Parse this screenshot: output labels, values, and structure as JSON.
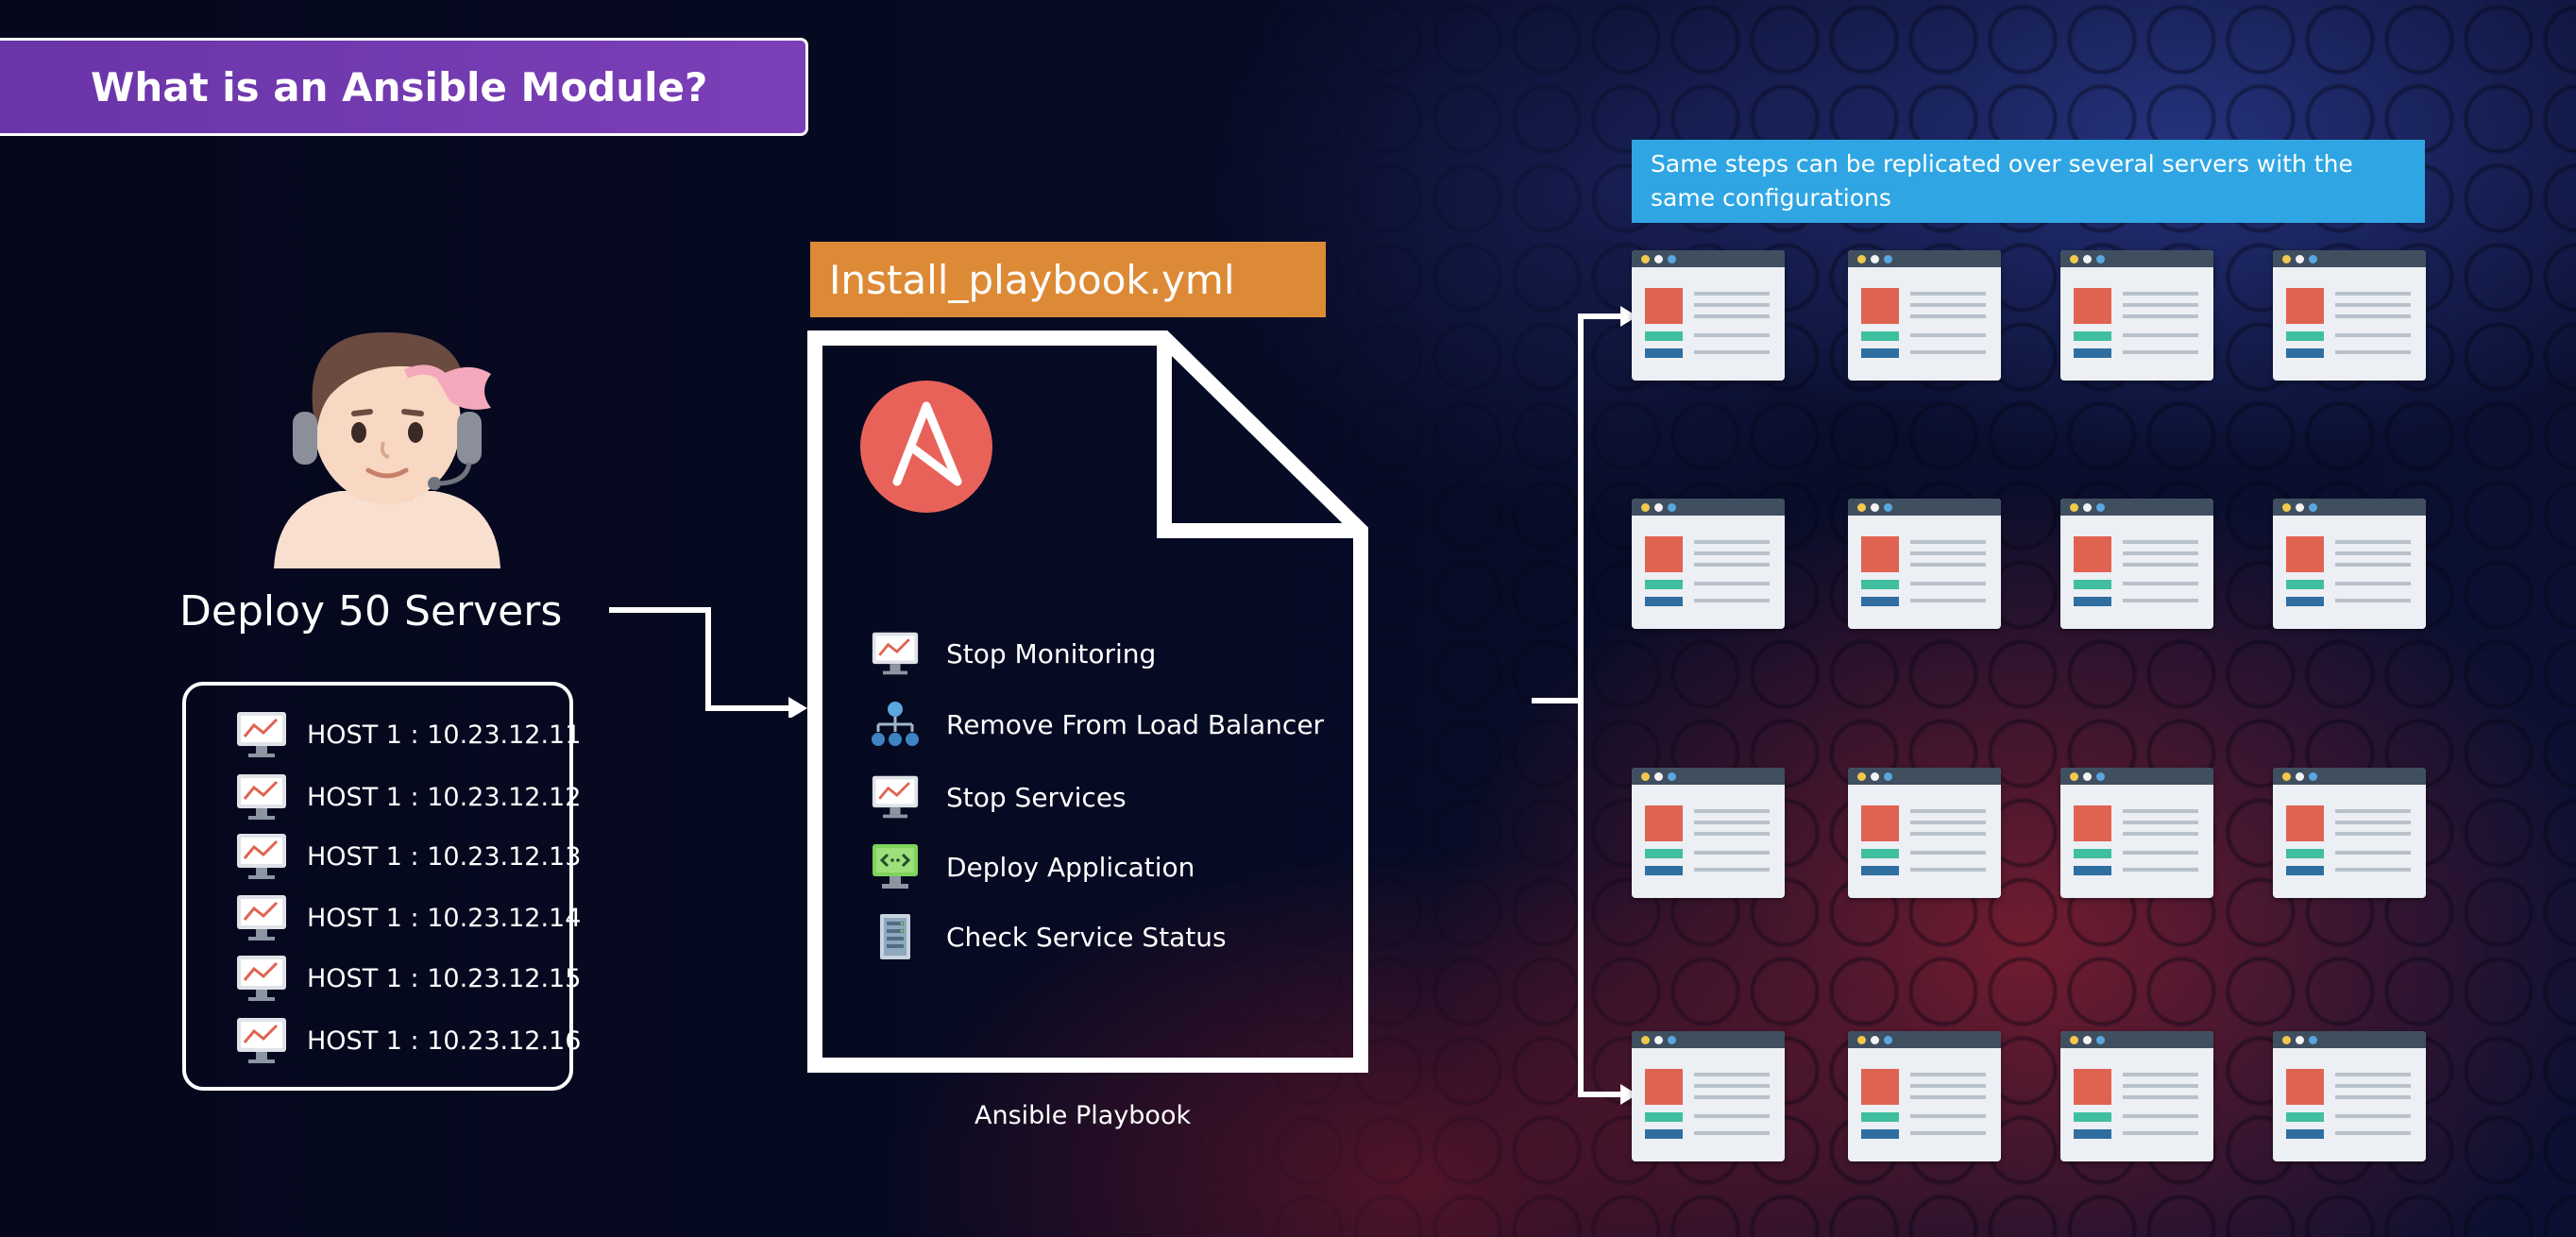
{
  "title": "What is an Ansible Module?",
  "presenter_label": "Deploy 50 Servers",
  "hosts": [
    "HOST 1 : 10.23.12.11",
    "HOST 1 : 10.23.12.12",
    "HOST 1 : 10.23.12.13",
    "HOST 1 : 10.23.12.14",
    "HOST 1 : 10.23.12.15",
    "HOST 1 : 10.23.12.16"
  ],
  "playbook": {
    "filename": "Install_playbook.yml",
    "caption": "Ansible Playbook",
    "logo_letter": "A",
    "steps": [
      {
        "label": "Stop Monitoring",
        "icon": "monitor-chart-icon"
      },
      {
        "label": "Remove From Load Balancer",
        "icon": "network-hierarchy-icon"
      },
      {
        "label": "Stop Services",
        "icon": "monitor-chart-icon"
      },
      {
        "label": "Deploy Application",
        "icon": "code-monitor-icon"
      },
      {
        "label": "Check Service Status",
        "icon": "server-rack-icon"
      }
    ]
  },
  "servers_note": "Same steps can be replicated over several servers with the same configurations",
  "server_grid": {
    "rows": 4,
    "columns": 4
  },
  "colors": {
    "title_bar": "#7b3fb8",
    "playbook_tag": "#dd8a36",
    "note_box": "#2fa6e3",
    "ansible_logo": "#e8625a"
  }
}
